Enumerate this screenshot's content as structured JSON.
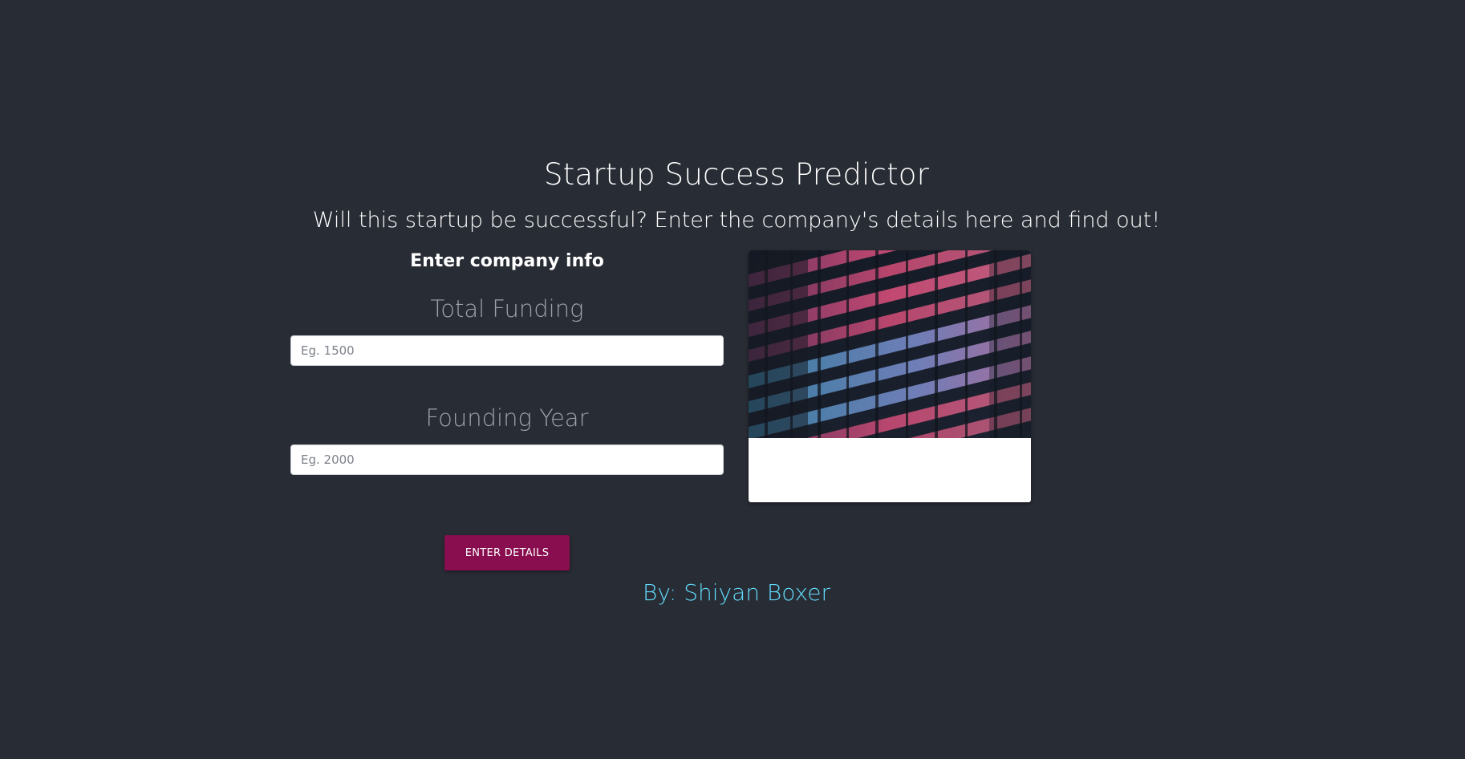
{
  "header": {
    "title": "Startup Success Predictor",
    "subtitle": "Will this startup be successful? Enter the company's details here and find out!"
  },
  "form": {
    "heading": "Enter company info",
    "fields": [
      {
        "label": "Total Funding",
        "placeholder": "Eg. 1500",
        "value": ""
      },
      {
        "label": "Founding Year",
        "placeholder": "Eg. 2000",
        "value": ""
      }
    ],
    "submit_label": "ENTER DETAILS"
  },
  "image": {
    "subject": "office-building-at-night-image"
  },
  "footer": {
    "author": "By: Shiyan Boxer"
  },
  "colors": {
    "background": "#282c34",
    "button": "#880e4f",
    "author": "#61dafb"
  }
}
